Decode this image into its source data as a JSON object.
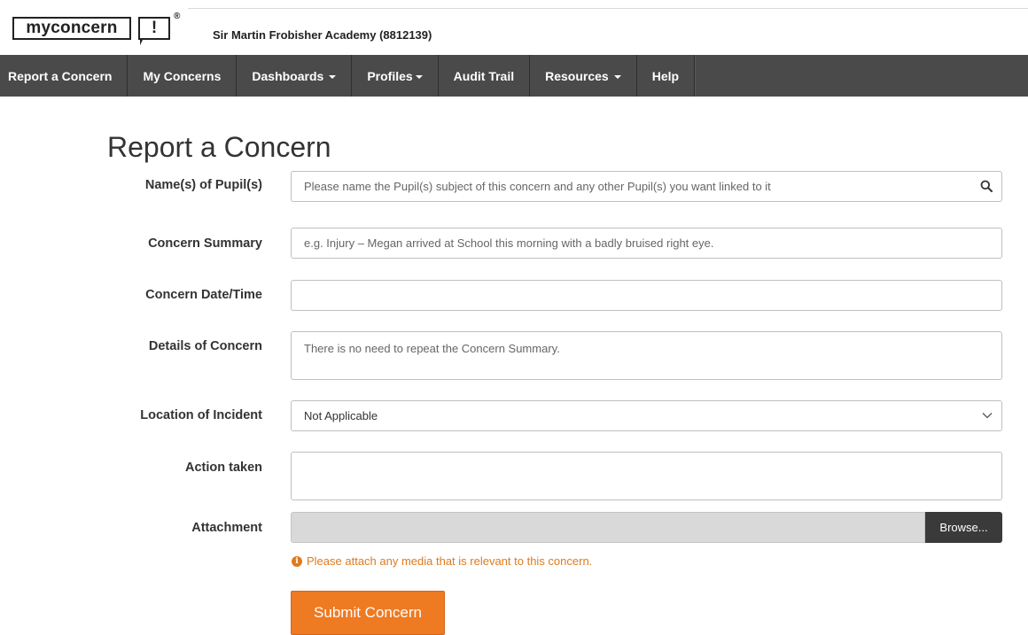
{
  "header": {
    "logo_word": "myconcern",
    "logo_mark": "!",
    "logo_reg": "®",
    "school_name": "Sir Martin Frobisher Academy (8812139)"
  },
  "nav": {
    "items": [
      {
        "label": "Report a Concern",
        "dropdown": false
      },
      {
        "label": "My Concerns",
        "dropdown": false
      },
      {
        "label": "Dashboards",
        "dropdown": true
      },
      {
        "label": "Profiles",
        "dropdown": true
      },
      {
        "label": "Audit Trail",
        "dropdown": false
      },
      {
        "label": "Resources",
        "dropdown": true
      },
      {
        "label": "Help",
        "dropdown": false
      }
    ]
  },
  "form": {
    "title": "Report a Concern",
    "pupils": {
      "label": "Name(s) of Pupil(s)",
      "placeholder": "Please name the Pupil(s) subject of this concern and any other Pupil(s) you want linked to it",
      "icon": "search-icon"
    },
    "summary": {
      "label": "Concern Summary",
      "placeholder": "e.g. Injury – Megan arrived at School this morning with a badly bruised right eye."
    },
    "datetime": {
      "label": "Concern Date/Time",
      "value": ""
    },
    "details": {
      "label": "Details of Concern",
      "placeholder": "There is no need to repeat the Concern Summary."
    },
    "location": {
      "label": "Location of Incident",
      "value": "Not Applicable",
      "icon": "chevron-down-icon"
    },
    "action": {
      "label": "Action taken",
      "value": ""
    },
    "attachment": {
      "label": "Attachment",
      "browse_label": "Browse...",
      "hint": "Please attach any media that is relevant to this concern.",
      "hint_icon": "info-icon"
    },
    "submit_label": "Submit Concern"
  },
  "colors": {
    "nav_bg": "#4a4a4a",
    "accent": "#ee7a22",
    "hint": "#e07a1e",
    "browse_bg": "#3a3a3a"
  }
}
